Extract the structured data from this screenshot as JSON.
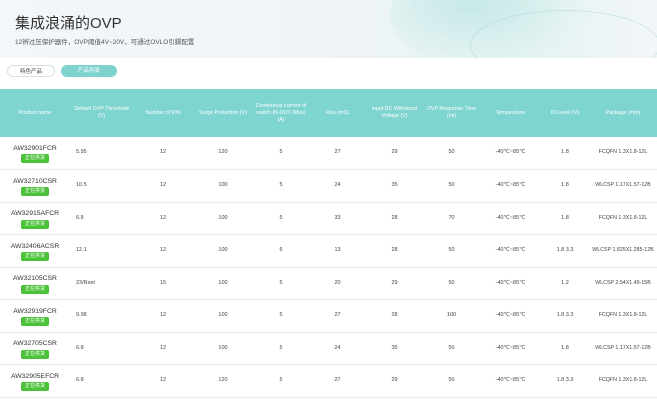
{
  "hero": {
    "title": "集成浪涌的OVP",
    "subtitle": "12辨过压保护器件，OVP阈值4V~20V，可通过OVLO引脚配置"
  },
  "tabs": [
    {
      "label": "特色产品"
    },
    {
      "label": "产品列表"
    }
  ],
  "table": {
    "headers": [
      "Product name",
      "Default OVP Threshold (V)",
      "Number of PIN",
      "Surge Protection (V)",
      "Continuous current of switch IN-OUT (Max) (A)",
      "Ron (mΩ)",
      "Input DC Withstand Voltage (V)",
      "OVP Response Time (ns)",
      "Temperature",
      "IO Level (V)",
      "Package (mm)"
    ],
    "badge_label": "正在供货",
    "rows": [
      {
        "name": "AW32901FCR",
        "ovp": "5.95",
        "pin": "12",
        "surge": "120",
        "current": "5",
        "ron": "27",
        "withstand": "29",
        "response": "50",
        "temp": "-40℃~85℃",
        "io": "1.8",
        "package": "FCQFN 1.3X1.8-12L"
      },
      {
        "name": "AW32710CSR",
        "ovp": "10.5",
        "pin": "12",
        "surge": "100",
        "current": "5",
        "ron": "24",
        "withstand": "35",
        "response": "50",
        "temp": "-40℃~85℃",
        "io": "1.8",
        "package": "WLCSP 1.17X1.57-12B"
      },
      {
        "name": "AW32915AFCR",
        "ovp": "6.8",
        "pin": "12",
        "surge": "100",
        "current": "5",
        "ron": "33",
        "withstand": "28",
        "response": "70",
        "temp": "-40℃~85℃",
        "io": "1.8",
        "package": "FCQFN 1.3X1.8-12L"
      },
      {
        "name": "AW32406ACSR",
        "ovp": "12.1",
        "pin": "12",
        "surge": "100",
        "current": "6",
        "ron": "13",
        "withstand": "28",
        "response": "50",
        "temp": "-40℃~85℃",
        "io": "1.8 3.3",
        "package": "WLCSP 1.825X1.285-12B"
      },
      {
        "name": "AW32105CSR",
        "ovp": "23/Rset",
        "pin": "15",
        "surge": "100",
        "current": "5",
        "ron": "20",
        "withstand": "29",
        "response": "50",
        "temp": "-40℃~85℃",
        "io": "1.2",
        "package": "WLCSP 2.54X1.49-15B"
      },
      {
        "name": "AW32919FCR",
        "ovp": "9.98",
        "pin": "12",
        "surge": "100",
        "current": "5",
        "ron": "27",
        "withstand": "28",
        "response": "100",
        "temp": "-40℃~85℃",
        "io": "1.8 3.3",
        "package": "FCQFN 1.3X1.8-12L"
      },
      {
        "name": "AW32705CSR",
        "ovp": "6.8",
        "pin": "12",
        "surge": "100",
        "current": "5",
        "ron": "24",
        "withstand": "35",
        "response": "50",
        "temp": "-40℃~85℃",
        "io": "1.8",
        "package": "WLCSP 1.17X1.57-12B"
      },
      {
        "name": "AW32905EFCR",
        "ovp": "6.8",
        "pin": "12",
        "surge": "120",
        "current": "5",
        "ron": "27",
        "withstand": "29",
        "response": "50",
        "temp": "-40℃~85℃",
        "io": "1.8 3.3",
        "package": "FCQFN 1.3X1.8-12L"
      }
    ]
  }
}
